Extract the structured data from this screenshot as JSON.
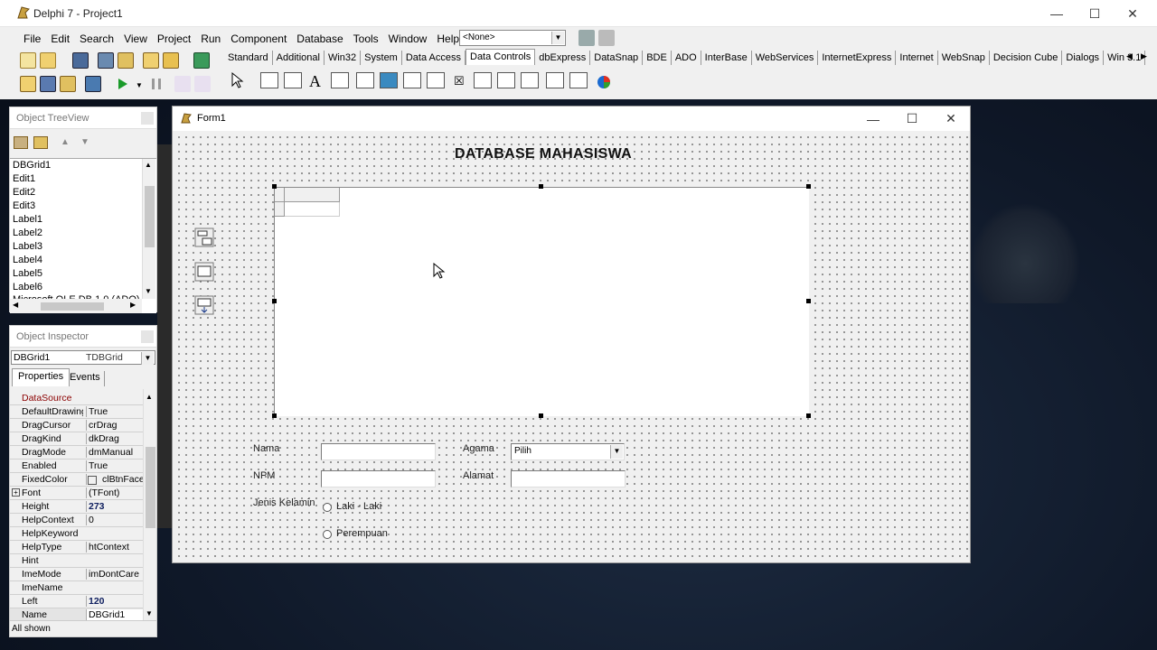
{
  "ide": {
    "title": "Delphi 7 - Project1",
    "menu": [
      "File",
      "Edit",
      "Search",
      "View",
      "Project",
      "Run",
      "Component",
      "Database",
      "Tools",
      "Window",
      "Help"
    ],
    "combo_value": "<None>",
    "palette_tabs": [
      "Standard",
      "Additional",
      "Win32",
      "System",
      "Data Access",
      "Data Controls",
      "dbExpress",
      "DataSnap",
      "BDE",
      "ADO",
      "InterBase",
      "WebServices",
      "InternetExpress",
      "Internet",
      "WebSnap",
      "Decision Cube",
      "Dialogs",
      "Win 3.1"
    ],
    "active_palette_tab": "Data Controls"
  },
  "tree_view": {
    "title": "Object TreeView",
    "items": [
      "DBGrid1",
      "Edit1",
      "Edit2",
      "Edit3",
      "Label1",
      "Label2",
      "Label3",
      "Label4",
      "Label5",
      "Label6",
      "Microsoft OLE DB 1.0 (ADO)"
    ]
  },
  "inspector": {
    "title": "Object Inspector",
    "selected_object": "DBGrid1",
    "selected_type": "TDBGrid",
    "tabs": [
      "Properties",
      "Events"
    ],
    "properties": [
      {
        "name": "DataSource",
        "value": ""
      },
      {
        "name": "DefaultDrawing",
        "value": "True"
      },
      {
        "name": "DragCursor",
        "value": "crDrag"
      },
      {
        "name": "DragKind",
        "value": "dkDrag"
      },
      {
        "name": "DragMode",
        "value": "dmManual"
      },
      {
        "name": "Enabled",
        "value": "True"
      },
      {
        "name": "FixedColor",
        "value": "clBtnFace"
      },
      {
        "name": "Font",
        "value": "(TFont)"
      },
      {
        "name": "Height",
        "value": "273"
      },
      {
        "name": "HelpContext",
        "value": "0"
      },
      {
        "name": "HelpKeyword",
        "value": ""
      },
      {
        "name": "HelpType",
        "value": "htContext"
      },
      {
        "name": "Hint",
        "value": ""
      },
      {
        "name": "ImeMode",
        "value": "imDontCare"
      },
      {
        "name": "ImeName",
        "value": ""
      },
      {
        "name": "Left",
        "value": "120"
      },
      {
        "name": "Name",
        "value": "DBGrid1"
      }
    ],
    "status": "All shown"
  },
  "form": {
    "title": "Form1",
    "heading": "DATABASE MAHASISWA",
    "labels": {
      "nama": "Nama",
      "npm": "NPM",
      "jenis_kelamin": "Jenis Kelamin",
      "agama": "Agama",
      "alamat": "Alamat"
    },
    "agama_combo_value": "Pilih",
    "radio_male": "Laki - Laki",
    "radio_female": "Perempuan"
  },
  "colors": {
    "desktop": "#0f1828",
    "ide_bg": "#f0f0f0",
    "prop_name_highlight": "#8b0000"
  }
}
